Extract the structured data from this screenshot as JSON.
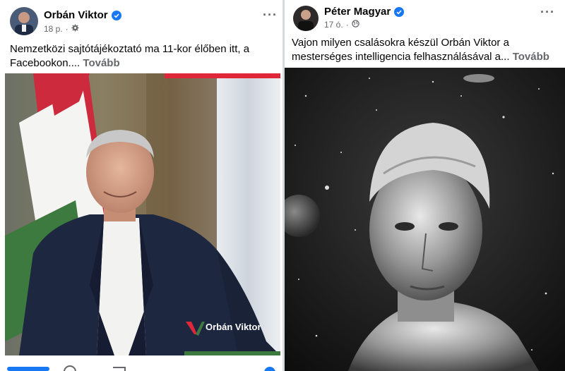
{
  "left_post": {
    "author": "Orbán Viktor",
    "time": "18 p.",
    "text": "Nemzetközi sajtótájékoztató ma 11-kor élőben itt, a Facebookon....",
    "more_label": "Tovább",
    "watermark": "Orbán Viktor",
    "icons": {
      "verified": "verified-badge-icon",
      "privacy": "gear-icon",
      "menu": "more-options-icon"
    }
  },
  "right_post": {
    "author": "Péter Magyar",
    "time": "17 ó.",
    "text": "Vajon milyen csalásokra készül Orbán Viktor a mesterséges intelligencia felhasználásával a...",
    "more_label": "Tovább",
    "icons": {
      "verified": "verified-badge-icon",
      "privacy": "globe-icon",
      "menu": "more-options-icon"
    }
  },
  "colors": {
    "verified_blue": "#1877f2",
    "flag_red": "#cd2a3e",
    "flag_green": "#3d7a3f",
    "watermark_red": "#e0273a"
  }
}
